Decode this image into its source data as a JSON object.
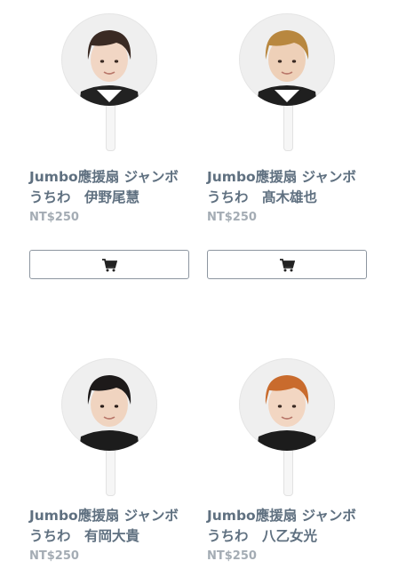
{
  "products": [
    {
      "title": "Jumbo應援扇 ジャンボうちわ　伊野尾慧",
      "price": "NT$250",
      "hair": "#3a2a23",
      "icon": "cart-icon"
    },
    {
      "title": "Jumbo應援扇 ジャンボうちわ　髙木雄也",
      "price": "NT$250",
      "hair": "#b8873f",
      "icon": "cart-icon"
    },
    {
      "title": "Jumbo應援扇 ジャンボうちわ　有岡大貴",
      "price": "NT$250",
      "hair": "#1d1a1a",
      "icon": "cart-icon"
    },
    {
      "title": "Jumbo應援扇 ジャンボうちわ　八乙女光",
      "price": "NT$250",
      "hair": "#c96b2d",
      "icon": "cart-icon"
    }
  ]
}
